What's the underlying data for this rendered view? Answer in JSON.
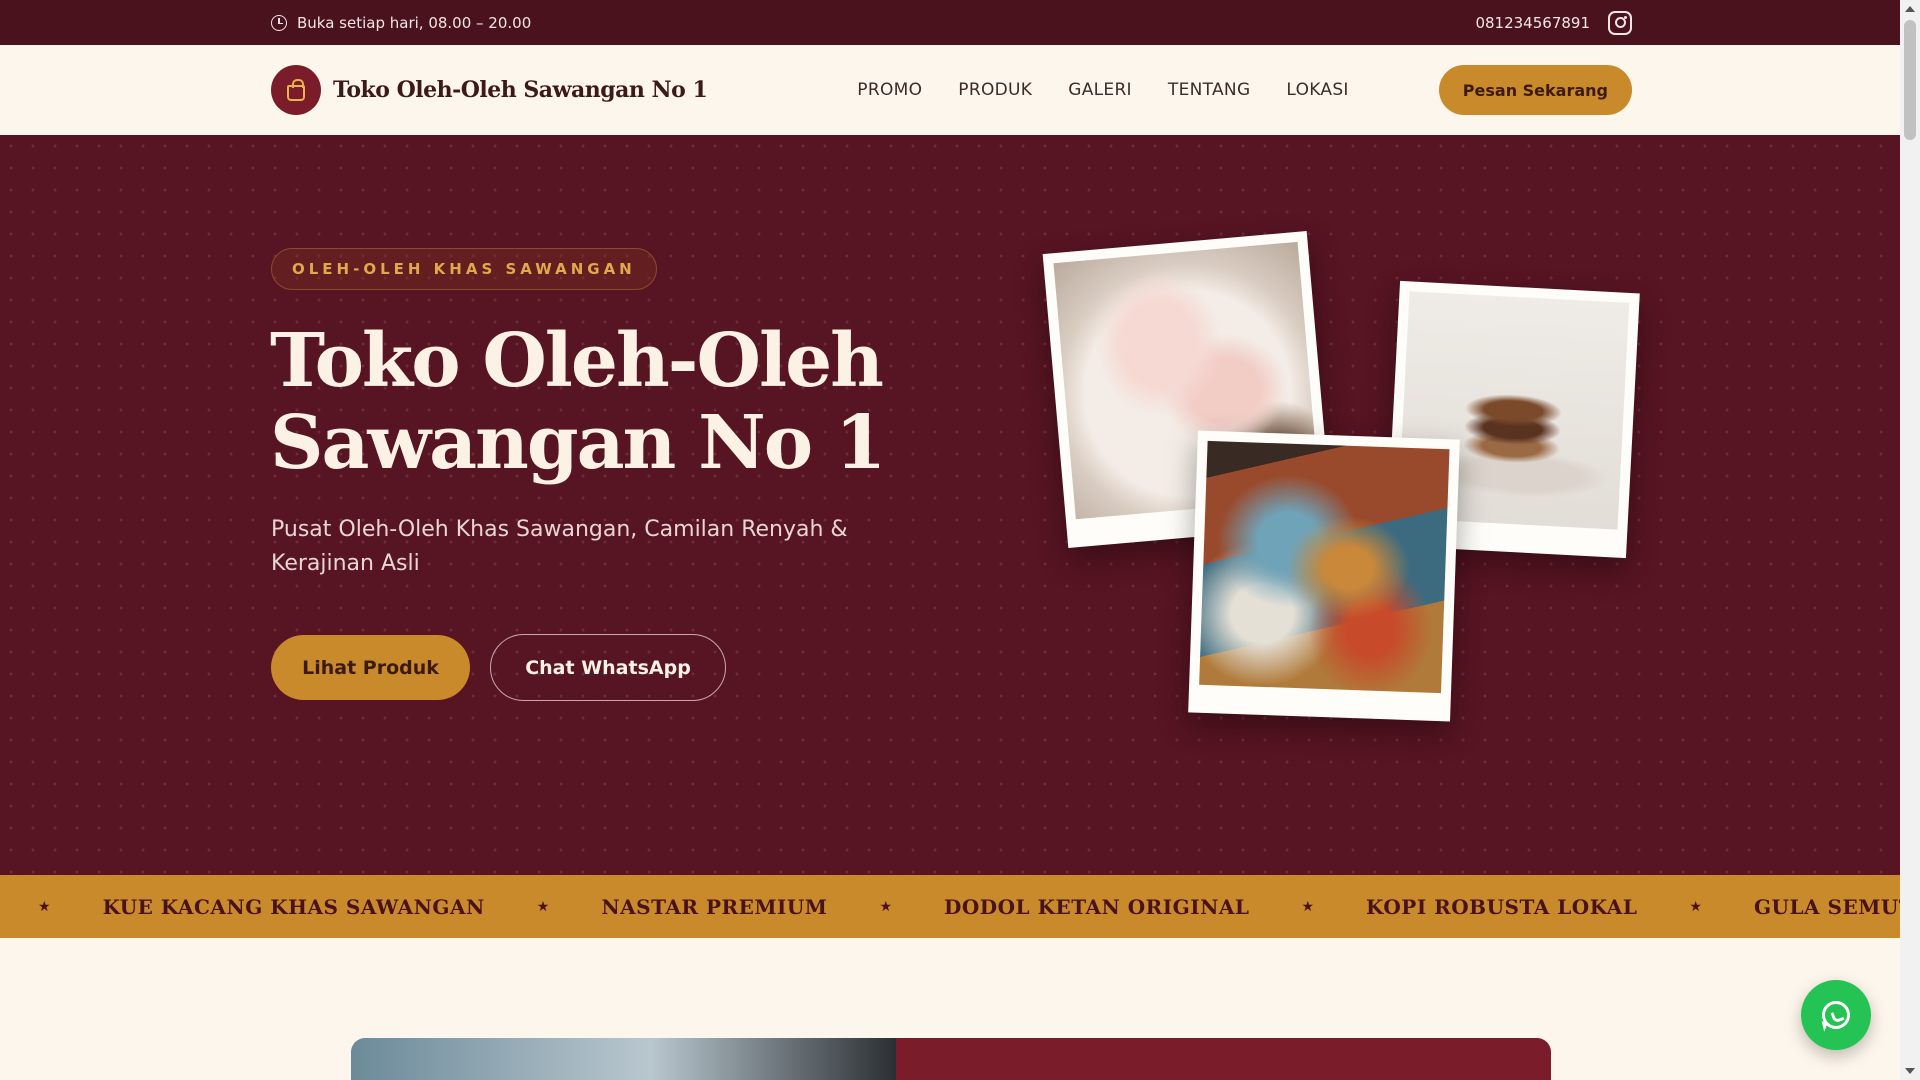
{
  "topbar": {
    "hours": "Buka setiap hari, 08.00 – 20.00",
    "phone": "081234567891",
    "clock_icon": "clock-icon",
    "instagram_icon": "instagram-icon"
  },
  "nav": {
    "brand_name": "Toko Oleh-Oleh Sawangan No 1",
    "logo_icon": "shopping-bag-icon",
    "menu": [
      "PROMO",
      "PRODUK",
      "GALERI",
      "TENTANG",
      "LOKASI"
    ],
    "cta": "Pesan Sekarang"
  },
  "hero": {
    "badge": "OLEH-OLEH KHAS SAWANGAN",
    "title_line1": "Toko Oleh-Oleh",
    "title_line2": "Sawangan No 1",
    "subtitle": "Pusat Oleh-Oleh Khas Sawangan, Camilan Renyah & Kerajinan Asli",
    "btn_primary": "Lihat Produk",
    "btn_secondary": "Chat WhatsApp"
  },
  "marquee": {
    "items": [
      "KUE KACANG KHAS SAWANGAN",
      "NASTAR PREMIUM",
      "DODOL KETAN ORIGINAL",
      "KOPI ROBUSTA LOKAL",
      "GULA SEMUT AREN"
    ],
    "separator": "★"
  },
  "fab": {
    "icon": "whatsapp-icon"
  },
  "colors": {
    "maroon_dark": "#4a121d",
    "maroon_hero": "#571422",
    "accent_gold": "#c98a2b",
    "cream": "#fdf6ec",
    "whatsapp_green": "#25c353"
  }
}
